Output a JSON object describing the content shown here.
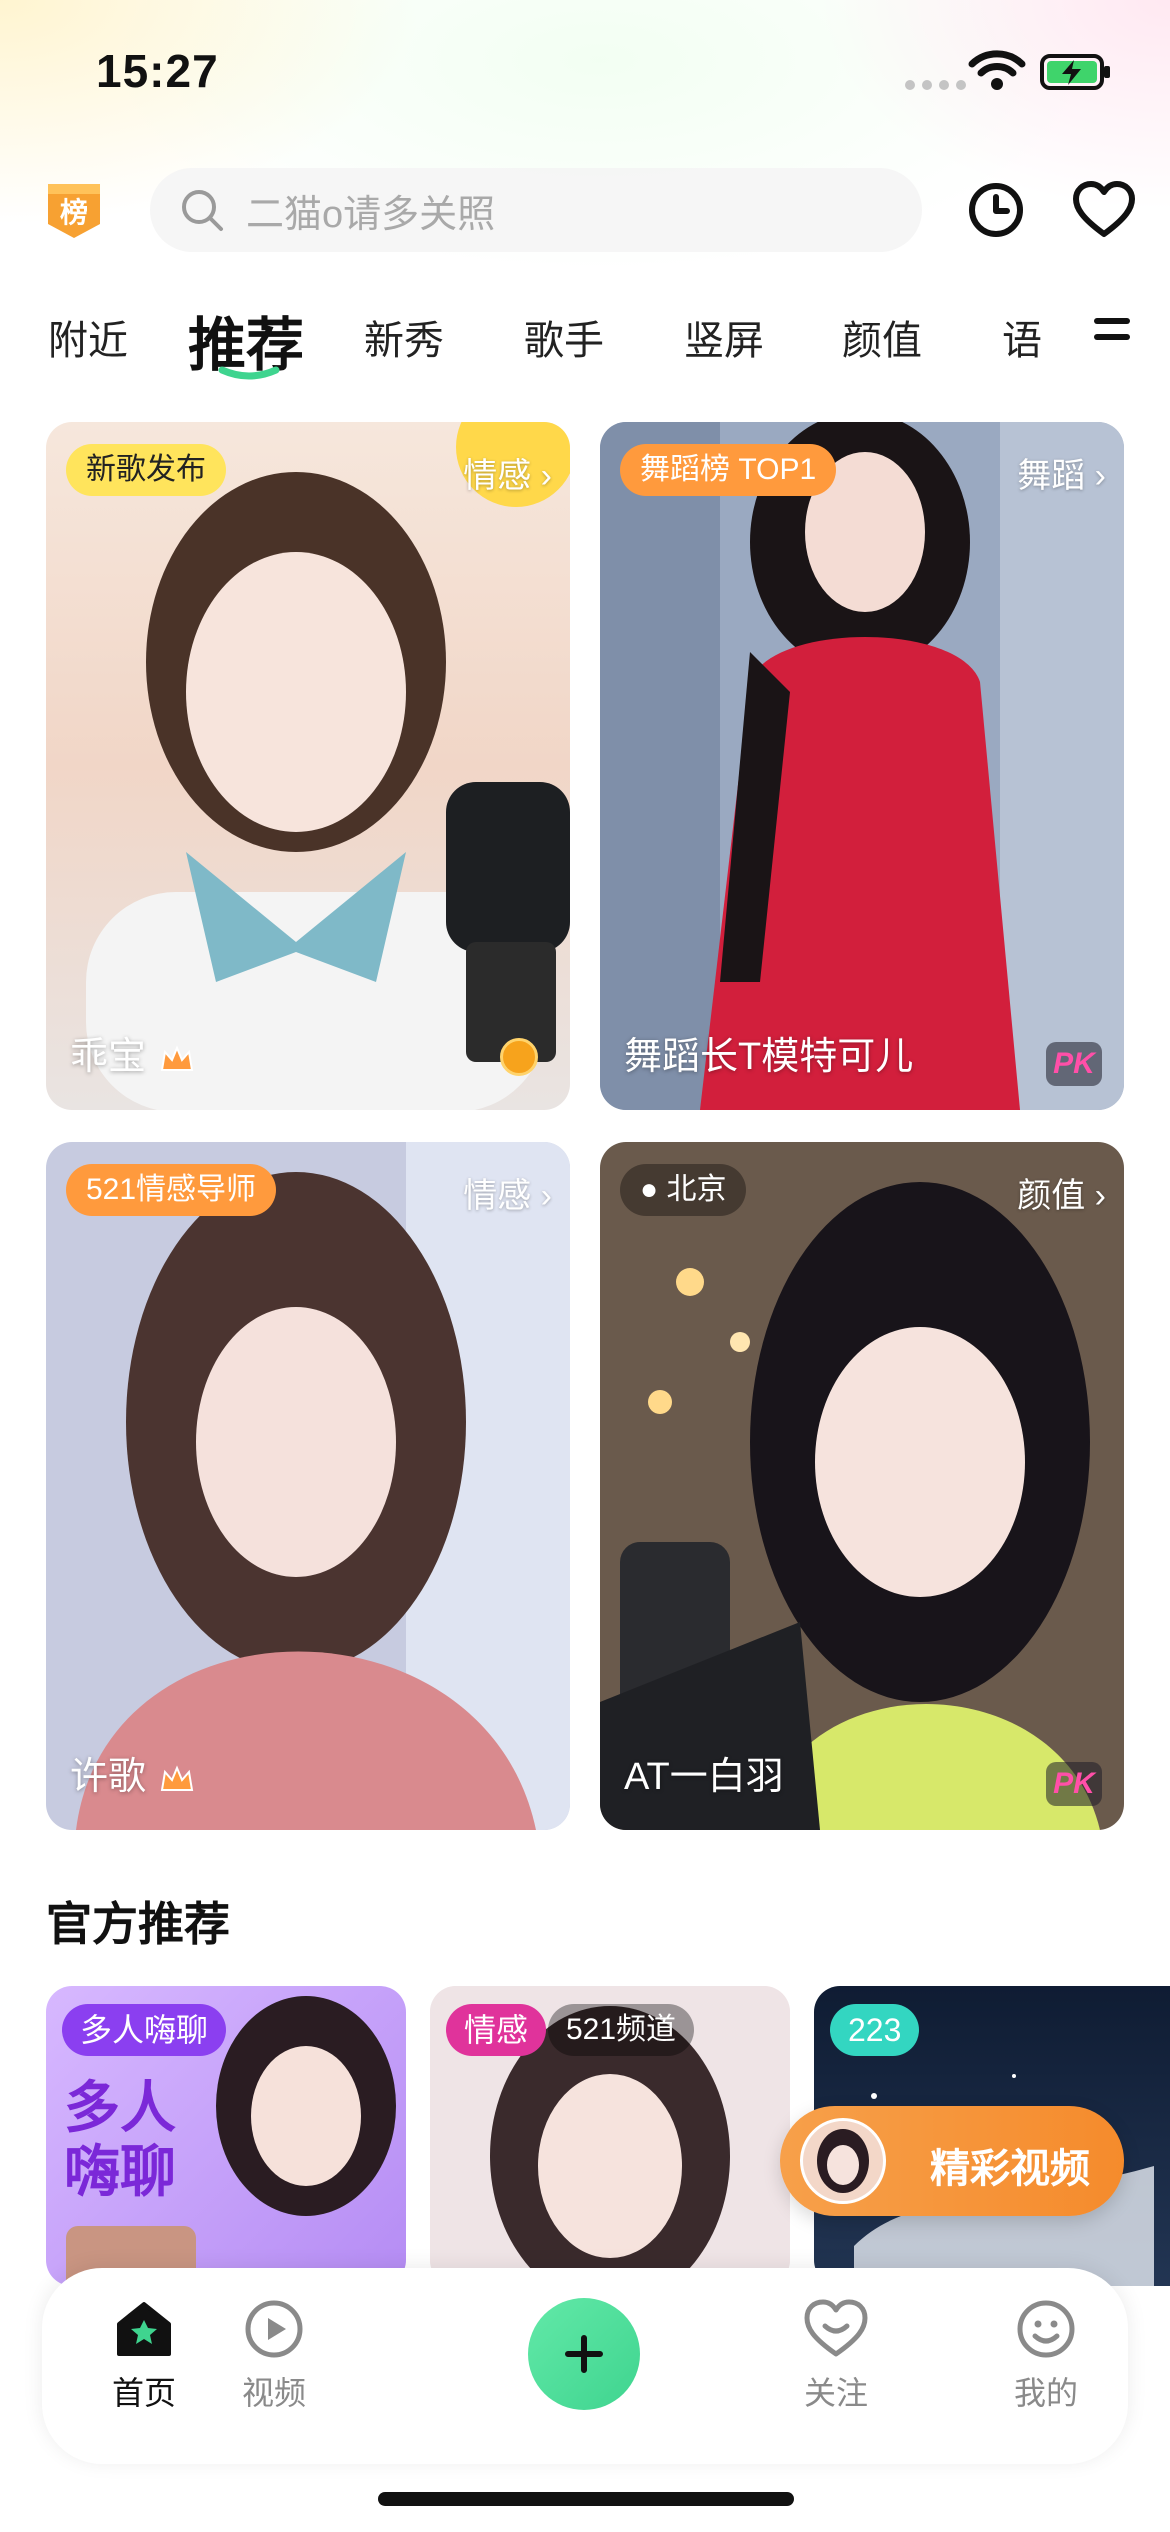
{
  "status_bar": {
    "time": "15:27"
  },
  "header": {
    "rank_badge": "榜",
    "search_placeholder": "二猫o请多关照"
  },
  "tabs": [
    {
      "label": "附近",
      "active": false
    },
    {
      "label": "推荐",
      "active": true
    },
    {
      "label": "新秀",
      "active": false
    },
    {
      "label": "歌手",
      "active": false
    },
    {
      "label": "竖屏",
      "active": false
    },
    {
      "label": "颜值",
      "active": false
    },
    {
      "label": "语",
      "active": false
    }
  ],
  "live_cards": [
    {
      "tag": "新歌发布",
      "tag_color": "#ffe45c",
      "category": "情感 ›",
      "name": "乖宝"
    },
    {
      "tag": "舞蹈榜 TOP1",
      "tag_color": "#ff9a3d",
      "category": "舞蹈 ›",
      "name": "舞蹈长T模特可儿",
      "badge": "PK"
    },
    {
      "tag": "521情感导师",
      "tag_color": "#ff9a3d",
      "category": "情感 ›",
      "name": "许歌"
    },
    {
      "tag": "北京",
      "tag_color": "rgba(0,0,0,0.35)",
      "category": "颜值 ›",
      "name": "AT一白羽",
      "badge": "PK"
    }
  ],
  "official": {
    "title": "官方推荐",
    "cards": [
      {
        "chip": "多人嗨聊",
        "chip_color": "#8b3ff0",
        "big_text": "多人\n嗨聊"
      },
      {
        "chip": "情感",
        "chip_color": "#e0339b",
        "chip2": "521频道"
      },
      {
        "chip": "223",
        "chip_color": "#33d6c1"
      }
    ]
  },
  "floating": {
    "label": "精彩视频"
  },
  "bottom_nav": [
    {
      "label": "首页",
      "icon": "home-icon",
      "active": true
    },
    {
      "label": "视频",
      "icon": "video-play-icon",
      "active": false
    },
    {
      "label": "关注",
      "icon": "follow-heart-icon",
      "active": false
    },
    {
      "label": "我的",
      "icon": "profile-smile-icon",
      "active": false
    }
  ],
  "colors": {
    "accent": "#3fd48f",
    "orange": "#f58b2c"
  }
}
